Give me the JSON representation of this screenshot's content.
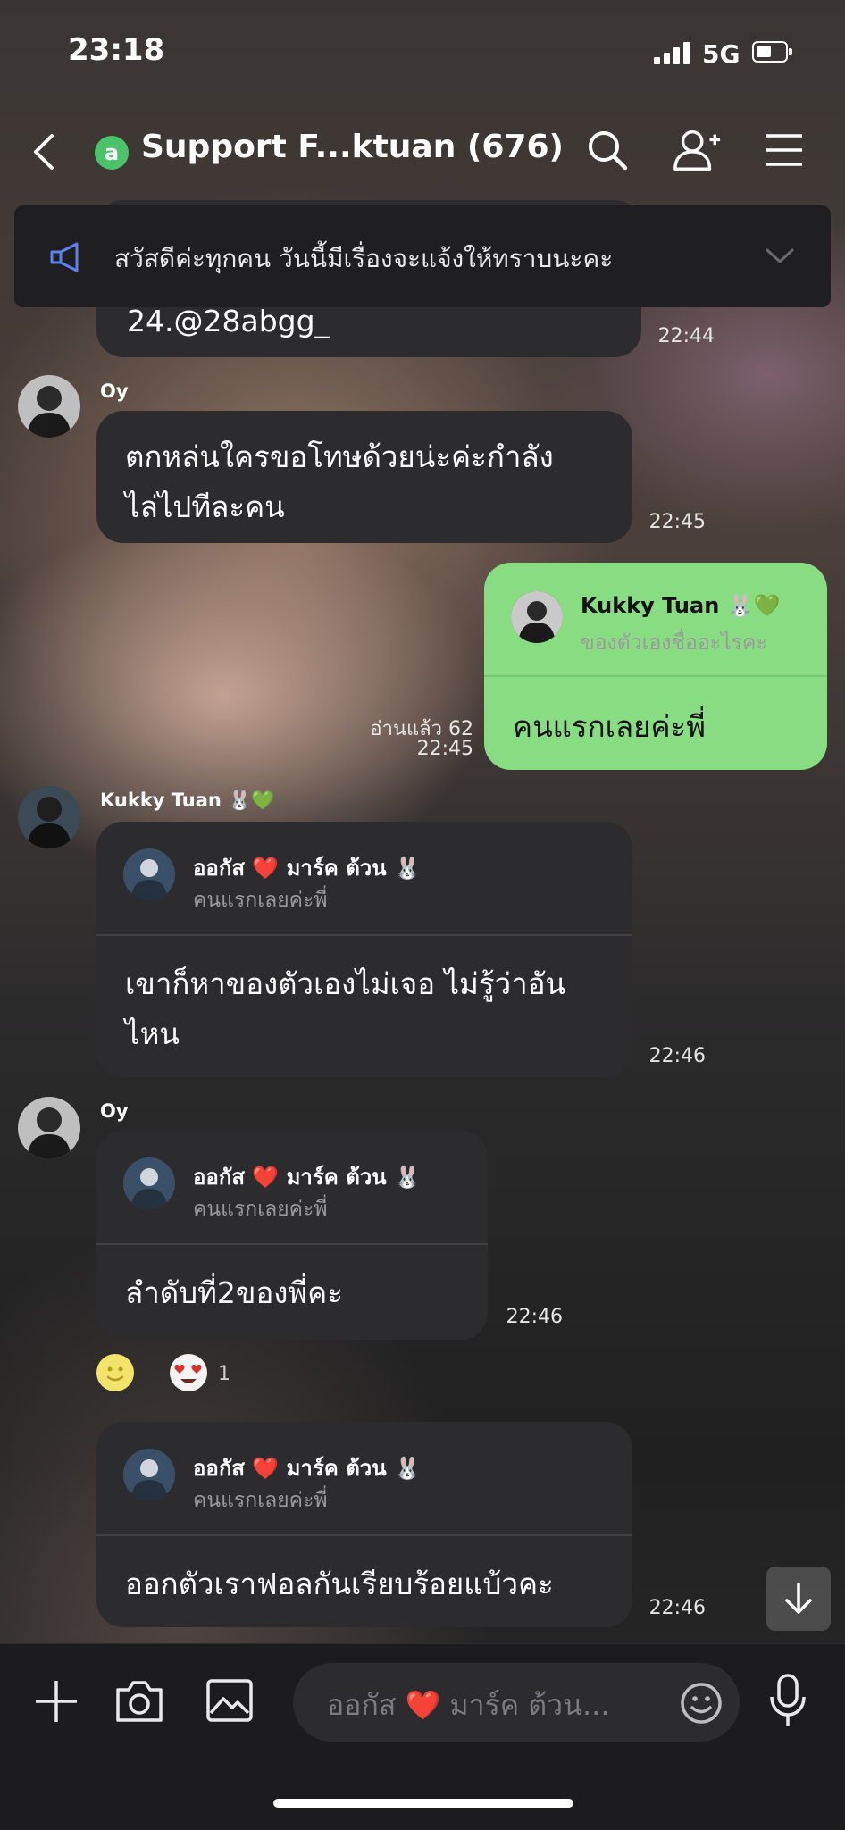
{
  "status_bar": {
    "time": "23:18",
    "network": "5G"
  },
  "header": {
    "title": "Support F...ktuan (676)",
    "official_badge": "a"
  },
  "announcement": {
    "text": "สวัสดีค่ะทุกคน วันนี้มีเรื่องจะแจ้งให้ทราบนะคะ"
  },
  "messages": [
    {
      "id": "m1",
      "text": "24.@28abgg_",
      "time": "22:44"
    },
    {
      "id": "m2",
      "sender": "Oy",
      "lines": [
        "ตกหล่นใครขอโทษด้วยน่ะค่ะกำลัง",
        "ไล่ไปทีละคน"
      ],
      "time": "22:45"
    },
    {
      "id": "m3",
      "quote_name": "Kukky Tuan 🐰💚",
      "quote_text": "ของตัวเองชื่ออะไรคะ",
      "text": "คนแรกเลยค่ะพี่",
      "read": "อ่านแล้ว 62",
      "time": "22:45"
    },
    {
      "id": "m4",
      "sender": "Kukky Tuan 🐰💚",
      "quote_name": "ออกัส ❤️ มาร์ค ต้วน 🐰",
      "quote_text": "คนแรกเลยค่ะพี่",
      "lines": [
        "เขาก็หาของตัวเองไม่เจอ ไม่รู้ว่าอัน",
        "ไหน"
      ],
      "time": "22:46"
    },
    {
      "id": "m5",
      "sender": "Oy",
      "quote_name": "ออกัส ❤️ มาร์ค ต้วน 🐰",
      "quote_text": "คนแรกเลยค่ะพี่",
      "text": "ลำดับที่2ของพี่คะ",
      "time": "22:46",
      "reaction_count": "1"
    },
    {
      "id": "m6",
      "quote_name": "ออกัส ❤️ มาร์ค ต้วน 🐰",
      "quote_text": "คนแรกเลยค่ะพี่",
      "text": "ออกตัวเราฟอลกันเรียบร้อยแบ้วคะ",
      "time": "22:46"
    }
  ],
  "composer": {
    "placeholder": "ออกัส ❤️ มาร์ค ต้วน..."
  },
  "colors": {
    "my_bubble": "#88dd82",
    "other_bubble": "#2c2c2e",
    "official_badge": "#4cc26a"
  }
}
